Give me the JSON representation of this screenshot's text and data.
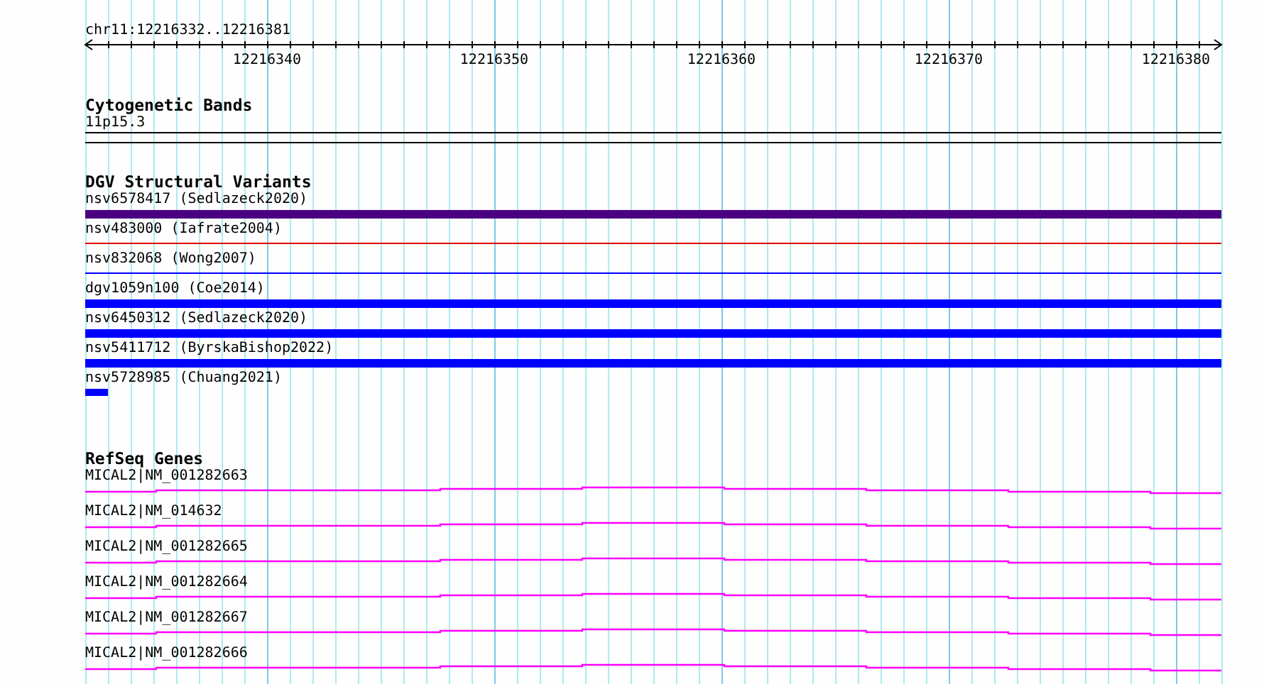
{
  "ruler": {
    "range": "chr11:12216332..12216381",
    "tick_labels": [
      "12216340",
      "12216350",
      "12216360",
      "12216370",
      "12216380"
    ]
  },
  "tracks": [
    {
      "title": "Cytogenetic Bands",
      "kind": "cytoband",
      "features": [
        {
          "label": "11p15.3",
          "kind": "band"
        }
      ]
    },
    {
      "title": "DGV Structural Variants",
      "kind": "variants",
      "features": [
        {
          "label": "nsv6578417 (Sedlazeck2020)",
          "kind": "bar",
          "color": "#4b0082"
        },
        {
          "label": "nsv483000 (Iafrate2004)",
          "kind": "line",
          "color": "#e00000"
        },
        {
          "label": "nsv832068 (Wong2007)",
          "kind": "line",
          "color": "#0000ff"
        },
        {
          "label": "dgv1059n100 (Coe2014)",
          "kind": "bar",
          "color": "#0000ff"
        },
        {
          "label": "nsv6450312 (Sedlazeck2020)",
          "kind": "bar",
          "color": "#0000ff"
        },
        {
          "label": "nsv5411712 (ByrskaBishop2022)",
          "kind": "bar",
          "color": "#0000ff"
        },
        {
          "label": "nsv5728985 (Chuang2021)",
          "kind": "stub",
          "color": "#0000ff"
        }
      ]
    },
    {
      "title": "RefSeq Genes",
      "kind": "genes",
      "features": [
        {
          "label": "MICAL2|NM_001282663",
          "kind": "intron"
        },
        {
          "label": "MICAL2|NM_014632",
          "kind": "intron"
        },
        {
          "label": "MICAL2|NM_001282665",
          "kind": "intron"
        },
        {
          "label": "MICAL2|NM_001282664",
          "kind": "intron"
        },
        {
          "label": "MICAL2|NM_001282667",
          "kind": "intron"
        },
        {
          "label": "MICAL2|NM_001282666",
          "kind": "intron"
        }
      ]
    }
  ]
}
